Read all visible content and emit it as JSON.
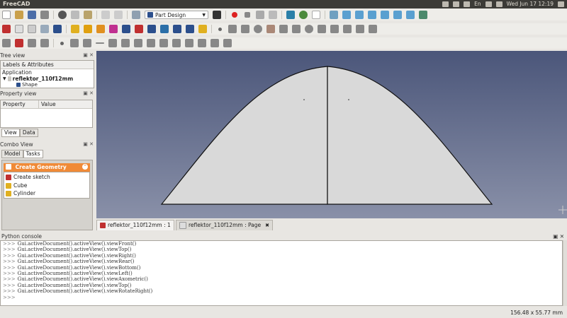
{
  "window": {
    "title": "FreeCAD"
  },
  "tray": {
    "clock": "Wed Jun 17 12:19",
    "lang": "En"
  },
  "workbench": {
    "selected": "Part Design"
  },
  "tree_view": {
    "title": "Tree view",
    "header": "Labels & Attributes",
    "app_label": "Application",
    "document": "reflektor_110f12mm",
    "child": "Shape"
  },
  "property_view": {
    "title": "Property view",
    "col_property": "Property",
    "col_value": "Value",
    "tabs": [
      "View",
      "Data"
    ]
  },
  "combo_view": {
    "title": "Combo View",
    "tabs": [
      "Model",
      "Tasks"
    ]
  },
  "task_panel": {
    "title": "Create Geometry",
    "items": [
      "Create sketch",
      "Cube",
      "Cylinder"
    ]
  },
  "doc_tabs": [
    {
      "label": "reflektor_110f12mm : 1",
      "active": true
    },
    {
      "label": "reflektor_110f12mm : Page",
      "active": false
    }
  ],
  "python_console": {
    "title": "Python console",
    "prompt": ">>>",
    "lines": [
      "Gui.activeDocument().activeView().viewFront()",
      "Gui.activeDocument().activeView().viewTop()",
      "Gui.activeDocument().activeView().viewRight()",
      "Gui.activeDocument().activeView().viewRear()",
      "Gui.activeDocument().activeView().viewBottom()",
      "Gui.activeDocument().activeView().viewLeft()",
      "Gui.activeDocument().activeView().viewAxometric()",
      "Gui.activeDocument().activeView().viewTop()",
      "Gui.activeDocument().activeView().viewRotateRight()"
    ]
  },
  "status": {
    "dimensions": "156.48 x 55.77 mm"
  },
  "colors": {
    "accent": "#f08a37",
    "view_bg_top": "#4b567a",
    "view_bg_bottom": "#8990a8",
    "shape_fill": "#d9d9d9"
  }
}
